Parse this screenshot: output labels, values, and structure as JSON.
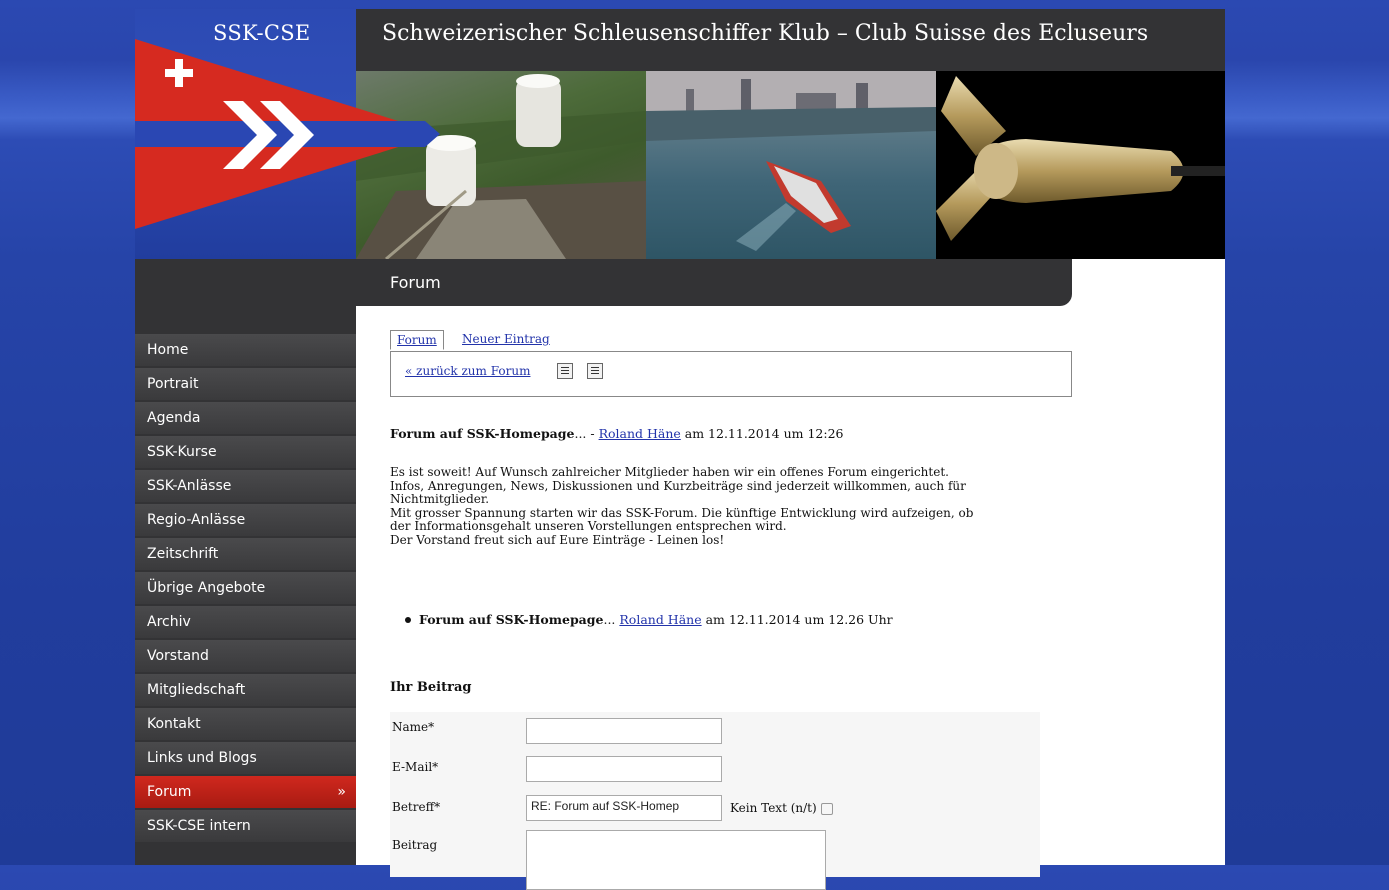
{
  "logo": {
    "text": "SSK-CSE"
  },
  "header": {
    "title": "Schweizerischer Schleusenschiffer Klub – Club Suisse des Ecluseurs"
  },
  "section": {
    "title": "Forum"
  },
  "nav": {
    "items": [
      {
        "label": "Home"
      },
      {
        "label": "Portrait"
      },
      {
        "label": "Agenda"
      },
      {
        "label": "SSK-Kurse"
      },
      {
        "label": "SSK-Anlässe"
      },
      {
        "label": "Regio-Anlässe"
      },
      {
        "label": "Zeitschrift"
      },
      {
        "label": "Übrige Angebote"
      },
      {
        "label": "Archiv"
      },
      {
        "label": "Vorstand"
      },
      {
        "label": "Mitgliedschaft"
      },
      {
        "label": "Kontakt"
      },
      {
        "label": "Links und Blogs"
      },
      {
        "label": "Forum",
        "arrow": "»"
      },
      {
        "label": "SSK-CSE intern"
      }
    ],
    "active_color": "#c8231a"
  },
  "tabs": {
    "forum": "Forum",
    "new_entry": "Neuer Eintrag",
    "back_link": "« zurück zum Forum"
  },
  "post": {
    "title": "Forum auf SSK-Homepage",
    "title_suffix": "... - ",
    "author": "Roland Häne",
    "meta": " am 12.11.2014 um 12:26",
    "body": [
      "Es ist soweit! Auf Wunsch zahlreicher Mitglieder haben wir ein offenes Forum eingerichtet.",
      "Infos, Anregungen, News, Diskussionen und Kurzbeiträge sind jederzeit willkommen, auch für",
      "Nichtmitglieder.",
      "Mit grosser Spannung starten wir das SSK-Forum. Die künftige Entwicklung wird aufzeigen, ob",
      "der Informationsgehalt unseren Vorstellungen entsprechen wird.",
      "Der Vorstand freut sich auf Eure Einträge - Leinen los!"
    ]
  },
  "thread": {
    "title": "Forum auf SSK-Homepage",
    "title_suffix": "... ",
    "author": "Roland Häne",
    "meta": " am 12.11.2014 um 12.26 Uhr"
  },
  "form": {
    "heading": "Ihr Beitrag",
    "name_label": "Name*",
    "email_label": "E-Mail*",
    "subject_label": "Betreff*",
    "subject_value": "RE: Forum auf SSK-Homep",
    "notext_label": "Kein Text (n/t)",
    "body_label": "Beitrag"
  },
  "colors": {
    "brand_blue": "#2644a8",
    "header_dark": "#333335",
    "link": "#2233aa",
    "flag_red": "#d62a20"
  }
}
